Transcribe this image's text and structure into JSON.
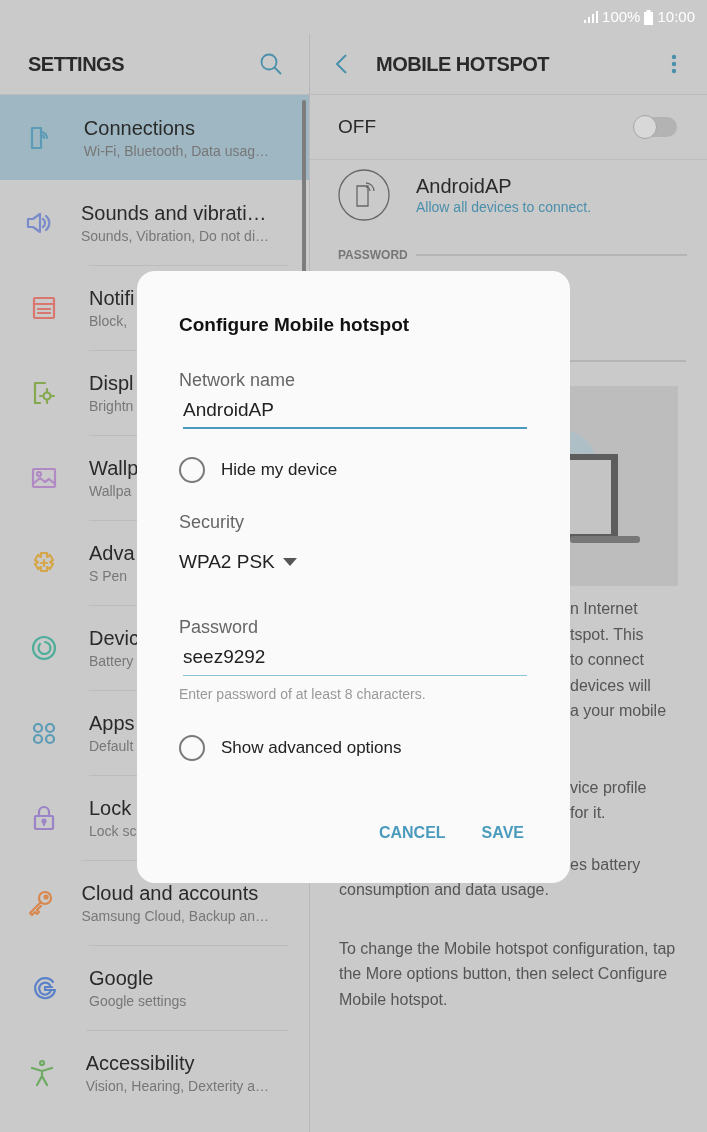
{
  "status_bar": {
    "battery": "100%",
    "time": "10:00"
  },
  "settings_header": {
    "title": "SETTINGS"
  },
  "settings_items": [
    {
      "title": "Connections",
      "subtitle": "Wi-Fi, Bluetooth, Data usag…",
      "selected": true,
      "color": "#5b9bb5"
    },
    {
      "title": "Sounds and vibrati…",
      "subtitle": "Sounds, Vibration, Do not di…",
      "selected": false,
      "color": "#7a8cc9"
    },
    {
      "title": "Notifi",
      "subtitle": "Block,",
      "selected": false,
      "color": "#d9776f"
    },
    {
      "title": "Displ",
      "subtitle": "Brightn",
      "selected": false,
      "color": "#86a84e"
    },
    {
      "title": "Wallp",
      "subtitle": "Wallpa",
      "selected": false,
      "color": "#b18ac5"
    },
    {
      "title": "Adva",
      "subtitle": "S Pen",
      "selected": false,
      "color": "#d6a64a"
    },
    {
      "title": "Devic",
      "subtitle": "Battery",
      "selected": false,
      "color": "#4fae9a"
    },
    {
      "title": "Apps",
      "subtitle": "Default",
      "selected": false,
      "color": "#5b9bb5"
    },
    {
      "title": "Lock",
      "subtitle": "Lock sc",
      "selected": false,
      "color": "#9a83c6"
    },
    {
      "title": "Cloud and accounts",
      "subtitle": "Samsung Cloud, Backup an…",
      "selected": false,
      "color": "#d9874d"
    },
    {
      "title": "Google",
      "subtitle": "Google settings",
      "selected": false,
      "color": "#5b82c9"
    },
    {
      "title": "Accessibility",
      "subtitle": "Vision, Hearing, Dexterity a…",
      "selected": false,
      "color": "#6faa63"
    }
  ],
  "hotspot_header": {
    "title": "MOBILE HOTSPOT"
  },
  "hotspot": {
    "state_label": "OFF",
    "on": false,
    "network_name": "AndroidAP",
    "network_hint": "Allow all devices to connect.",
    "password_header": "PASSWORD",
    "fragments_1": [
      "n Internet",
      "tspot. This",
      "to connect",
      "devices will",
      "a your mobile"
    ],
    "fragments_2": [
      "vice profile",
      "for it."
    ],
    "fragments_3": [
      "es battery"
    ],
    "line_after": "consumption and data usage.",
    "paragraph": "To change the Mobile hotspot configuration, tap the More options button, then select Configure Mobile hotspot."
  },
  "dialog": {
    "title": "Configure Mobile hotspot",
    "network_label": "Network name",
    "network_value": "AndroidAP",
    "hide_device": {
      "label": "Hide my device",
      "checked": false
    },
    "security_label": "Security",
    "security_value": "WPA2 PSK",
    "password_label": "Password",
    "password_value": "seez9292",
    "password_helper": "Enter password of at least 8 characters.",
    "advanced": {
      "label": "Show advanced options",
      "checked": false
    },
    "buttons": [
      "CANCEL",
      "SAVE"
    ]
  }
}
